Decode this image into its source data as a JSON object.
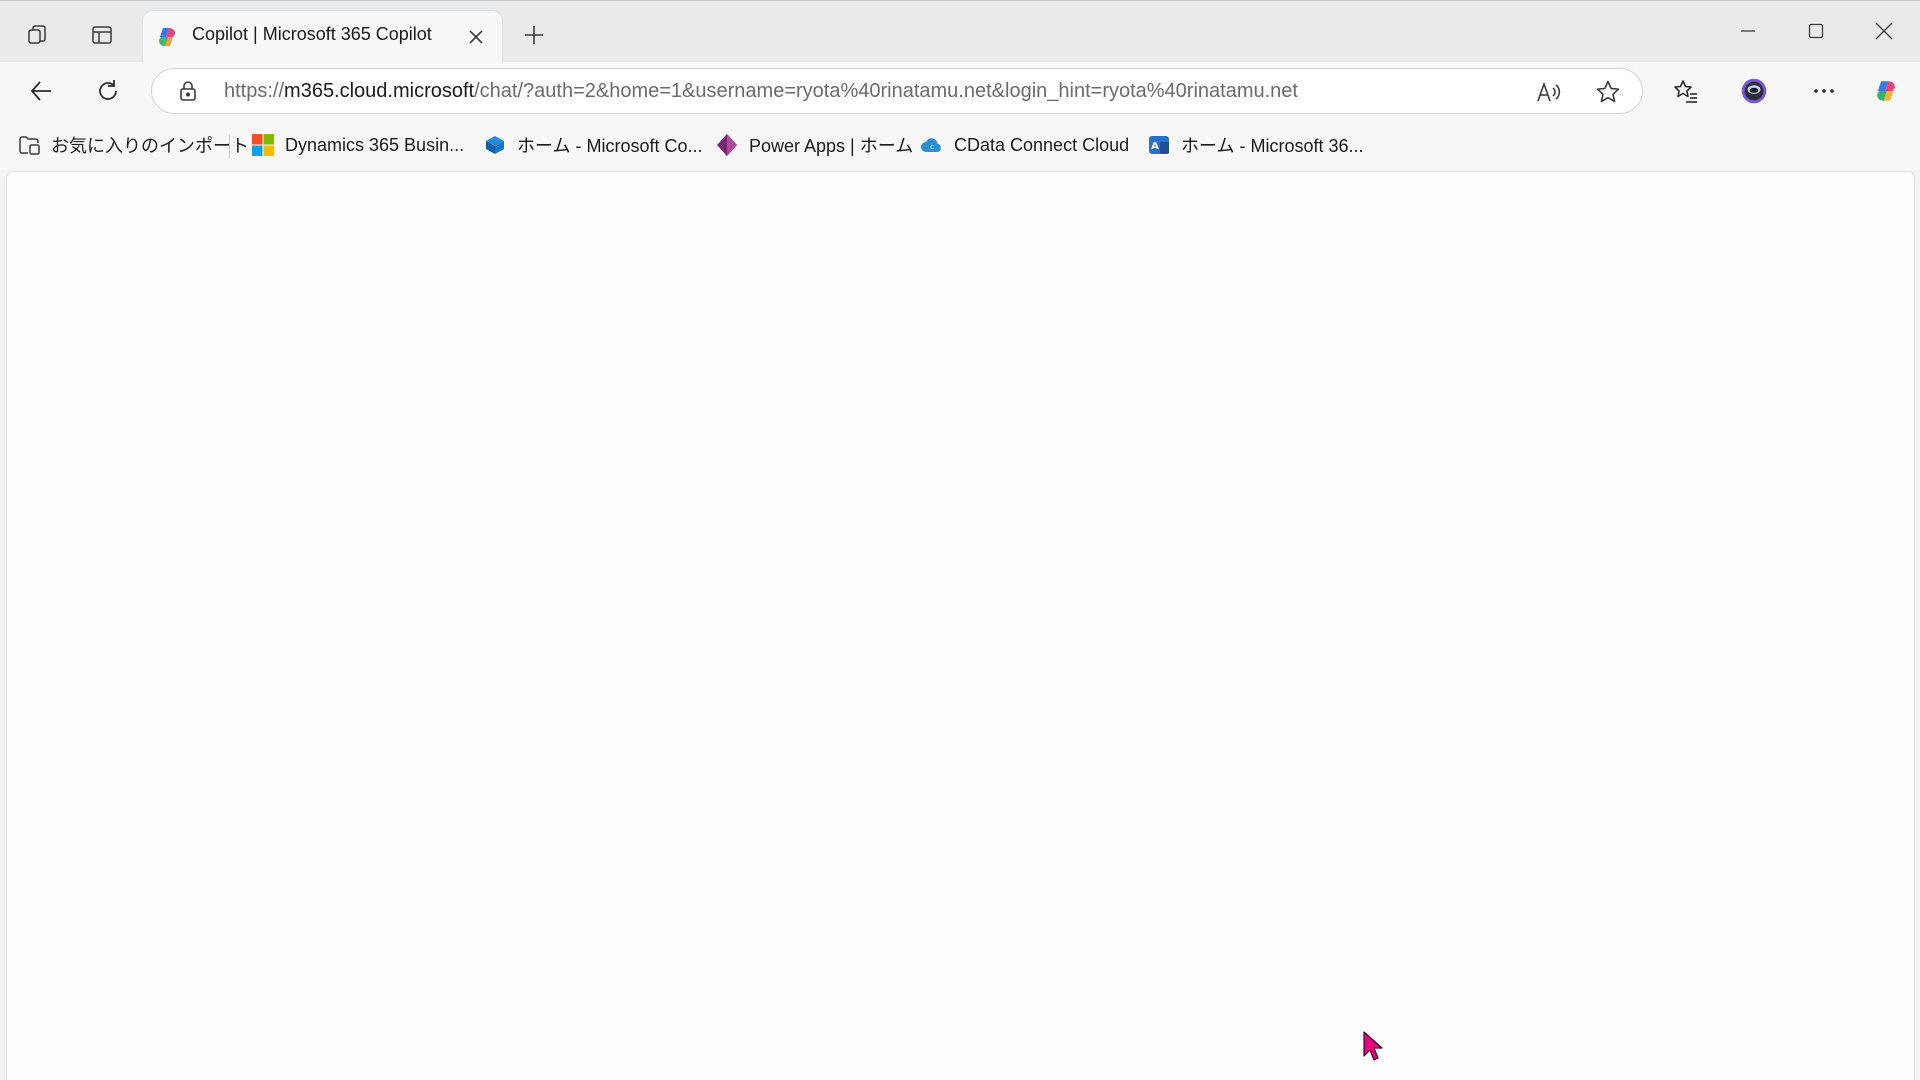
{
  "tab": {
    "title": "Copilot | Microsoft 365 Copilot"
  },
  "address_bar": {
    "url_prefix": "https://",
    "url_host": "m365.cloud.microsoft",
    "url_path": "/chat/?auth=2&home=1&username=ryota%40rinatamu.net&login_hint=ryota%40rinatamu.net"
  },
  "favorites": [
    {
      "label": "お気に入りのインポート",
      "icon": "import-favorites-icon"
    },
    {
      "label": "Dynamics 365 Busin...",
      "icon": "microsoft-logo-icon"
    },
    {
      "label": "ホーム - Microsoft Co...",
      "icon": "copilot-studio-icon"
    },
    {
      "label": "Power Apps | ホーム",
      "icon": "power-apps-icon"
    },
    {
      "label": "CData Connect Cloud",
      "icon": "cdata-cloud-icon"
    },
    {
      "label": "ホーム - Microsoft 36...",
      "icon": "m365-admin-icon"
    }
  ],
  "colors": {
    "tabstrip_bg": "#e9eaec",
    "toolbar_bg": "#f7f7f7",
    "content_bg": "#fdfefd",
    "cursor_color": "#e6007e"
  }
}
